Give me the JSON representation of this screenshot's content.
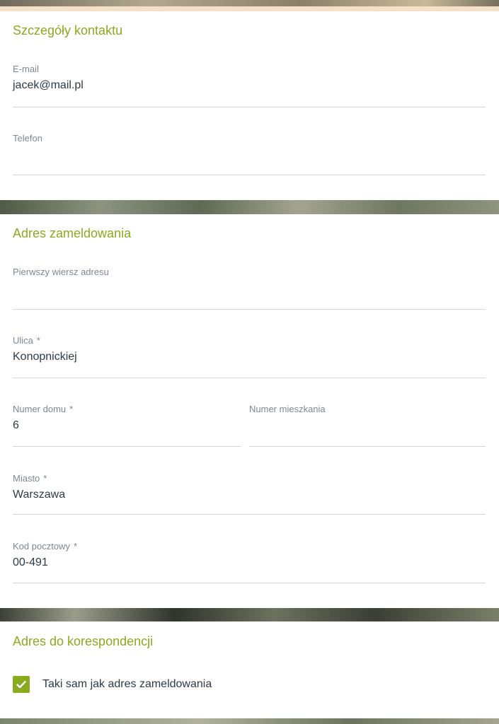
{
  "contact": {
    "title": "Szczegóły kontaktu",
    "email": {
      "label": "E-mail",
      "value": "jacek@mail.pl"
    },
    "phone": {
      "label": "Telefon",
      "value": ""
    }
  },
  "registered_address": {
    "title": "Adres zameldowania",
    "address_line1": {
      "label": "Pierwszy wiersz adresu",
      "value": ""
    },
    "street": {
      "label": "Ulica",
      "required_mark": "*",
      "value": "Konopnickiej"
    },
    "house_number": {
      "label": "Numer domu",
      "required_mark": "*",
      "value": "6"
    },
    "apartment_number": {
      "label": "Numer mieszkania",
      "value": ""
    },
    "city": {
      "label": "Miasto",
      "required_mark": "*",
      "value": "Warszawa"
    },
    "postal_code": {
      "label": "Kod pocztowy",
      "required_mark": "*",
      "value": "00-491"
    }
  },
  "correspondence_address": {
    "title": "Adres do korespondencji",
    "same_as_registered": {
      "label": "Taki sam jak adres zameldowania",
      "checked": true,
      "icon": "check-icon"
    }
  },
  "colors": {
    "accent": "#8aaa1f",
    "label": "#7d8791",
    "text": "#2f3a43",
    "underline": "#d3d6d8"
  }
}
